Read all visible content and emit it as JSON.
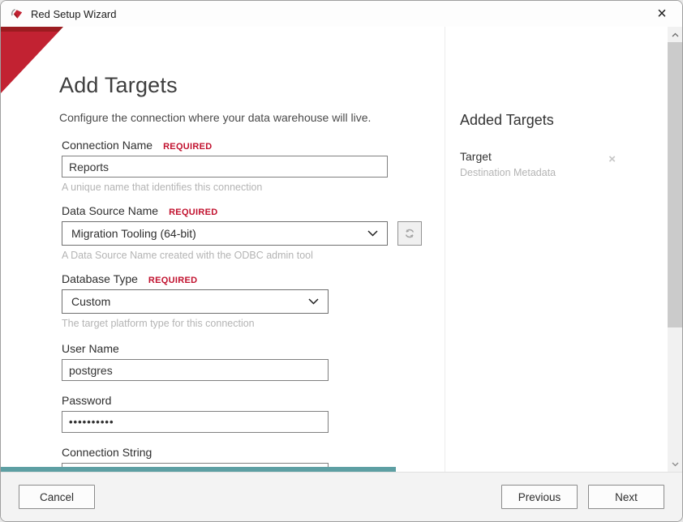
{
  "window": {
    "title": "Red Setup Wizard",
    "close_glyph": "×"
  },
  "colors": {
    "brand_red": "#c22232",
    "brand_red_dark": "#9b1c20",
    "required_red": "#c1112e",
    "progress_teal": "#5d9fa3"
  },
  "page": {
    "title": "Add Targets",
    "subtitle": "Configure the connection where your data warehouse will live."
  },
  "form": {
    "required_badge": "REQUIRED",
    "connection_name": {
      "label": "Connection Name",
      "value": "Reports",
      "helper": "A unique name that identifies this connection"
    },
    "data_source_name": {
      "label": "Data Source Name",
      "value": "Migration Tooling (64-bit)",
      "helper": "A Data Source Name created with the ODBC admin tool"
    },
    "database_type": {
      "label": "Database Type",
      "value": "Custom",
      "helper": "The target platform type for this connection"
    },
    "user_name": {
      "label": "User Name",
      "value": "postgres"
    },
    "password": {
      "label": "Password",
      "value": "••••••••••"
    },
    "connection_string": {
      "label": "Connection String",
      "value": ""
    }
  },
  "added_targets": {
    "title": "Added Targets",
    "remove_glyph": "×",
    "items": [
      {
        "name": "Target",
        "description": "Destination Metadata"
      }
    ]
  },
  "progress": {
    "width_percent": 58
  },
  "footer": {
    "cancel": "Cancel",
    "previous": "Previous",
    "next": "Next"
  }
}
